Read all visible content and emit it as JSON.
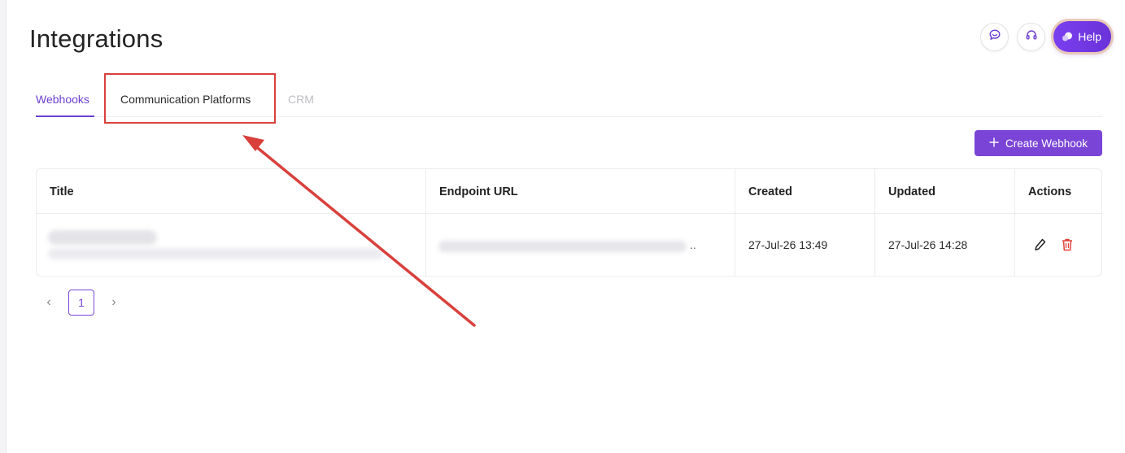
{
  "page": {
    "title": "Integrations"
  },
  "header_actions": {
    "chat_icon": "chat-bubble-icon",
    "support_icon": "headset-icon",
    "help_label": "Help"
  },
  "tabs": [
    {
      "label": "Webhooks",
      "active": true
    },
    {
      "label": "Communication Platforms",
      "active": false,
      "highlighted": true
    },
    {
      "label": "CRM",
      "active": false,
      "disabled": true
    }
  ],
  "toolbar": {
    "create_label": "Create Webhook"
  },
  "table": {
    "columns": [
      "Title",
      "Endpoint URL",
      "Created",
      "Updated",
      "Actions"
    ],
    "rows": [
      {
        "title": "",
        "endpoint_suffix": "..",
        "created": "27-Jul-26 13:49",
        "updated": "27-Jul-26 14:28"
      }
    ]
  },
  "pagination": {
    "current_page": "1"
  },
  "colors": {
    "accent": "#7a44d6",
    "annotation": "#d9403c",
    "delete": "#e0443c"
  }
}
